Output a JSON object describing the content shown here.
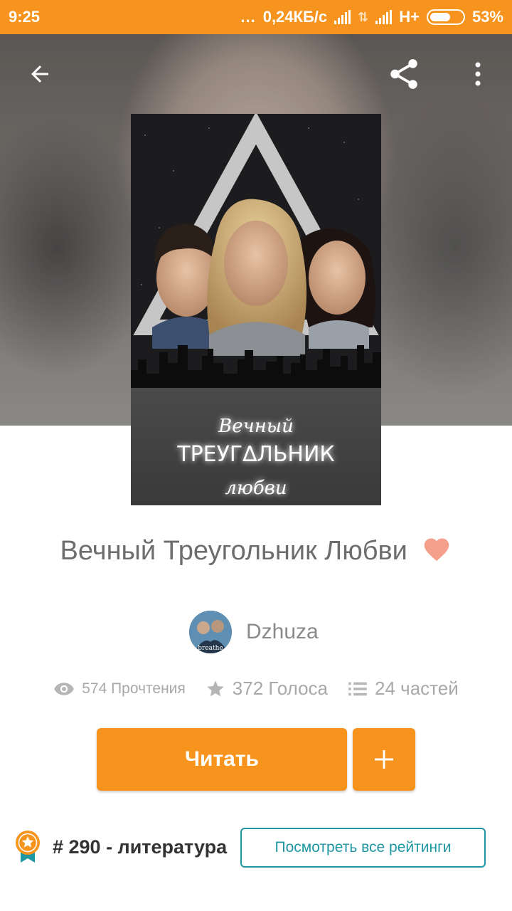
{
  "status_bar": {
    "time": "9:25",
    "dots": "...",
    "speed": "0,24КБ/с",
    "network": "H+",
    "battery": "53%"
  },
  "toolbar": {
    "back_icon": "arrow-left-icon",
    "share_icon": "share-icon",
    "menu_icon": "more-vertical-icon"
  },
  "book": {
    "title": "Вечный Треугольник Любви",
    "cover_text": [
      "Вечный",
      "ТРЕУГ∆ЛЬНИК",
      "любви"
    ],
    "heart_color": "#f4a08c",
    "author": "Dzhuza",
    "avatar_text": "breathe"
  },
  "stats": {
    "reads": "574 Прочтения",
    "votes": "372 Голоса",
    "parts": "24 частей"
  },
  "actions": {
    "read_label": "Читать",
    "add_label": "+"
  },
  "ranking": {
    "rank_text": "# 290 - литература",
    "view_all_label": "Посмотреть все рейтинги"
  },
  "colors": {
    "accent": "#f7941d",
    "teal": "#1f97a3"
  }
}
